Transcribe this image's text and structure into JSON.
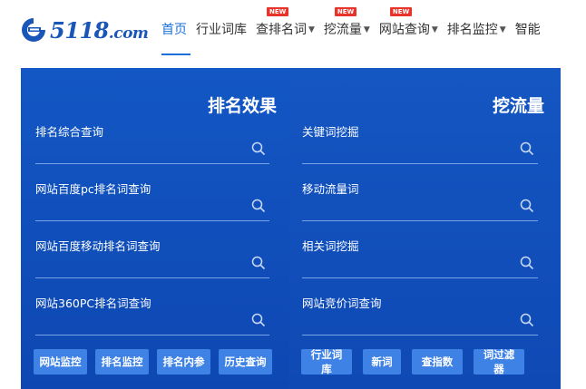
{
  "brand": {
    "name": "5118",
    "domain": ".com",
    "color": "#1a56b8"
  },
  "nav": {
    "items": [
      {
        "label": "首页",
        "active": true,
        "dropdown": false,
        "new": false
      },
      {
        "label": "行业词库",
        "active": false,
        "dropdown": false,
        "new": false
      },
      {
        "label": "查排名词",
        "active": false,
        "dropdown": true,
        "new": true
      },
      {
        "label": "挖流量",
        "active": false,
        "dropdown": true,
        "new": true
      },
      {
        "label": "网站查询",
        "active": false,
        "dropdown": true,
        "new": true
      },
      {
        "label": "排名监控",
        "active": false,
        "dropdown": true,
        "new": false
      },
      {
        "label": "智能",
        "active": false,
        "dropdown": false,
        "new": false
      }
    ],
    "new_badge": "NEW",
    "caret_icon": "caret-down-icon"
  },
  "panels": {
    "ranking": {
      "title": "排名效果",
      "queries": [
        {
          "label": "排名综合查询",
          "value": "",
          "placeholder": ""
        },
        {
          "label": "网站百度pc排名词查询",
          "value": "",
          "placeholder": ""
        },
        {
          "label": "网站百度移动排名词查询",
          "value": "",
          "placeholder": ""
        },
        {
          "label": "网站360PC排名词查询",
          "value": "",
          "placeholder": ""
        }
      ],
      "buttons": [
        "网站监控",
        "排名监控",
        "排名内参",
        "历史查询"
      ]
    },
    "traffic": {
      "title": "挖流量",
      "queries": [
        {
          "label": "关键词挖掘",
          "value": "",
          "placeholder": ""
        },
        {
          "label": "移动流量词",
          "value": "",
          "placeholder": ""
        },
        {
          "label": "相关词挖掘",
          "value": "",
          "placeholder": ""
        },
        {
          "label": "网站竞价词查询",
          "value": "",
          "placeholder": ""
        }
      ],
      "buttons": [
        "行业词库",
        "新词",
        "查指数",
        "词过滤器"
      ]
    }
  },
  "colors": {
    "accent": "#1a70d8",
    "panel_bg": "#1357c4",
    "button_bg": "#3f82e6",
    "badge_red": "#e8342a"
  }
}
